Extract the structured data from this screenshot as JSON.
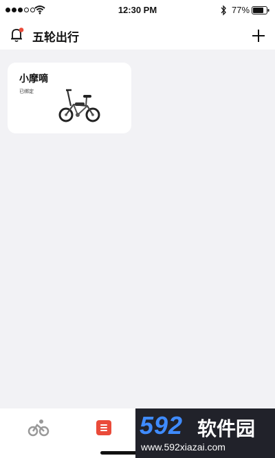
{
  "status_bar": {
    "time": "12:30 PM",
    "battery": "77%",
    "icons": [
      "signal-dots",
      "wifi-icon",
      "bluetooth-icon",
      "battery-icon"
    ]
  },
  "header": {
    "title": "五轮出行",
    "left_icon": "bell-icon",
    "right_icon": "plus-icon"
  },
  "vehicle": {
    "name": "小摩嘀",
    "status": "已绑定",
    "image": "e-bike"
  },
  "tab_bar": {
    "tabs": [
      {
        "icon": "bike-icon"
      },
      {
        "icon": "list-icon",
        "active": true
      }
    ],
    "accent": "#ea4b3a"
  },
  "watermark": {
    "logo": "592",
    "name": "软件园",
    "url": "www.592xiazai.com"
  }
}
